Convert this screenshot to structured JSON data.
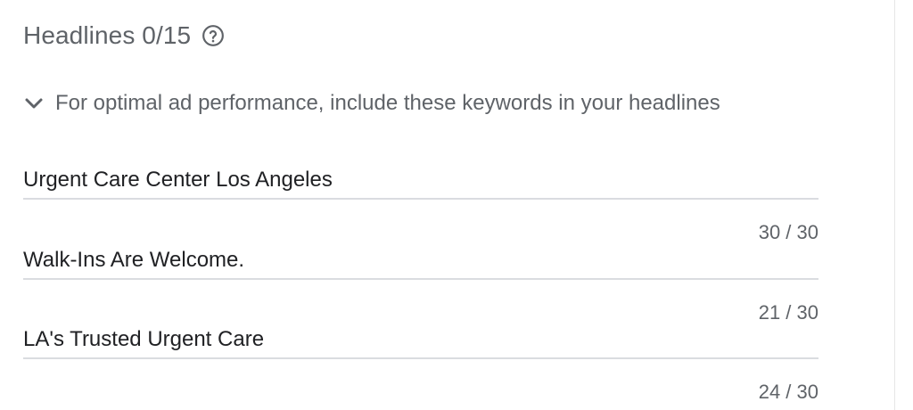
{
  "header": {
    "title": "Headlines 0/15",
    "help_icon": "help-circle-icon"
  },
  "keyword_hint": {
    "icon": "chevron-down-icon",
    "text": "For optimal ad performance, include these keywords in your headlines",
    "expanded": true
  },
  "headlines": [
    {
      "value": "Urgent Care Center Los Angeles",
      "counter": "30 / 30"
    },
    {
      "value": "Walk-Ins Are Welcome.",
      "counter": "21 / 30"
    },
    {
      "value": "LA's Trusted Urgent Care",
      "counter": "24 / 30"
    }
  ],
  "colors": {
    "secondary_text": "#5f6368",
    "primary_text": "#202124",
    "divider": "#dadce0"
  }
}
